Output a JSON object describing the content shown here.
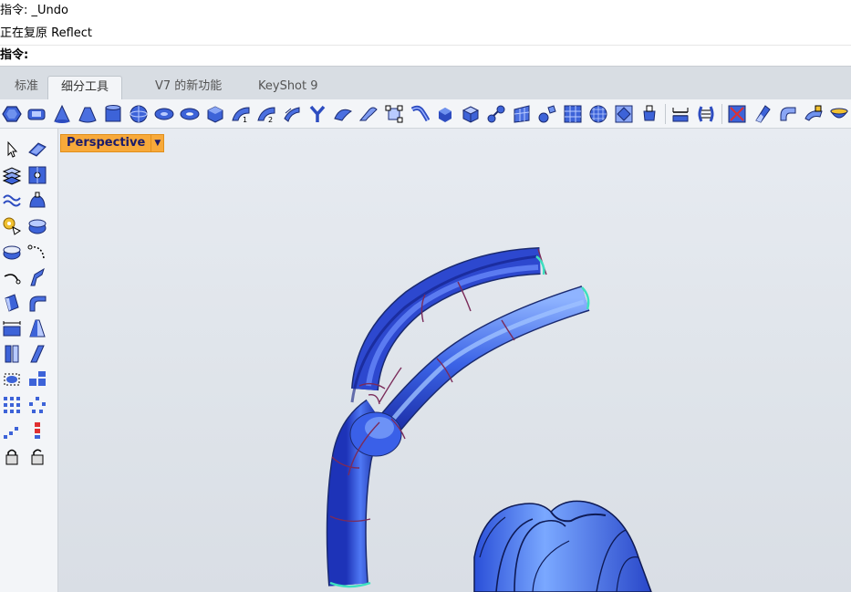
{
  "command_history": {
    "line1": "指令: _Undo",
    "line2": "正在复原 Reflect"
  },
  "command_prompt": {
    "label": "指令:",
    "value": ""
  },
  "tabs": [
    {
      "label": "标准",
      "active": false
    },
    {
      "label": "细分工具",
      "active": true
    },
    {
      "label": "V7 的新功能",
      "active": false
    },
    {
      "label": "KeyShot 9",
      "active": false
    }
  ],
  "toolbar_icons": [
    "subd-box-icon",
    "subd-cylinder-ring-icon",
    "subd-cone-icon",
    "subd-truncated-cone-icon",
    "subd-cylinder-icon",
    "subd-sphere-icon",
    "subd-ellipsoid-icon",
    "subd-torus-icon",
    "subd-cube-icon",
    "subd-loft-icon",
    "subd-sweep2-icon",
    "subd-sweep1-icon",
    "subd-multipipe-icon",
    "subd-patch-icon",
    "subd-fillet-icon",
    "subd-transform-icon",
    "subd-pipe-icon",
    "subd-box-solid-icon",
    "subd-box-smooth-icon",
    "subd-bridge-icon",
    "subd-plane-mesh-icon",
    "subd-to-nurbs-icon",
    "subd-grid-icon",
    "subd-sphere-grid-icon",
    "subd-quad-icon",
    "subd-cup-icon",
    "subd-insert-edge-icon",
    "subd-stitch-icon",
    "subd-crease-icon",
    "subd-slide-icon",
    "subd-bevel-icon",
    "subd-offset-icon",
    "subd-bowl-icon"
  ],
  "viewport": {
    "label": "Perspective",
    "dropdown_icon": "triangle-down-icon"
  },
  "colors": {
    "label_bg": "#f7a93a",
    "label_text": "#1b1b6a",
    "tube_blue": "#2f52e0",
    "isocurve": "#7b2b5a",
    "edge_highlight": "#3ee0c0"
  }
}
